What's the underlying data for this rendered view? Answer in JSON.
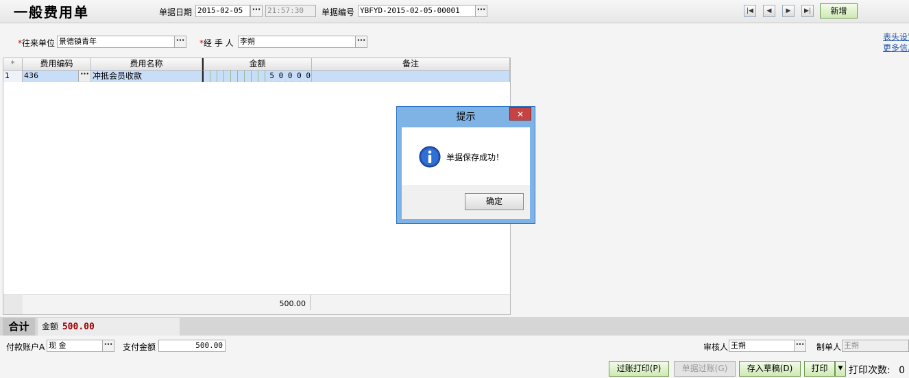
{
  "header": {
    "title": "一般费用单",
    "date_label": "单据日期",
    "date_value": "2015-02-05",
    "time_value": "21:57:30",
    "number_label": "单据编号",
    "number_value": "YBFYD-2015-02-05-00001",
    "new_button": "新增",
    "ellipsis": "···"
  },
  "form": {
    "partner_label": "往来单位",
    "partner_value": "景德镇青年",
    "handler_label": "经 手 人",
    "handler_value": "李朔",
    "required_mark": "*",
    "link_header_settings": "表头设置",
    "link_more_info": "更多信息"
  },
  "grid": {
    "columns": [
      "*",
      "费用编码",
      "费用名称",
      "金额",
      "备注"
    ],
    "rows": [
      {
        "index": "1",
        "code": "436",
        "name": "冲抵会员收款",
        "amount": "5 0 0 0 0",
        "note": ""
      }
    ],
    "footer_total": "500.00"
  },
  "totals": {
    "label": "合计",
    "amount_label": "金额",
    "amount_value": "500.00"
  },
  "bottom": {
    "account_label": "付款账户A",
    "account_value": "现    金",
    "pay_label": "支付金额",
    "pay_value": "500.00",
    "auditor_label": "审核人",
    "auditor_value": "王朔",
    "maker_label": "制单人",
    "maker_value": "王朔"
  },
  "actions": {
    "post_print": "过账打印(P)",
    "post": "单据过账(G)",
    "save_draft": "存入草稿(D)",
    "print": "打印",
    "print_count_label": "打印次数:",
    "print_count_value": "0"
  },
  "dialog": {
    "title": "提示",
    "message": "单据保存成功！",
    "ok_button": "确定",
    "close": "✕"
  }
}
